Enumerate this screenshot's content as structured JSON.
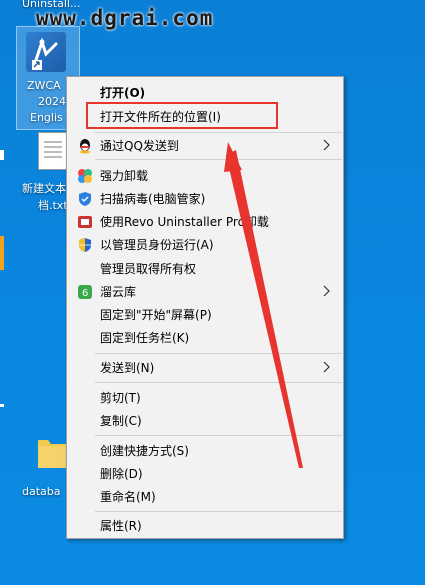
{
  "desktop": {
    "top_label": "Uninstall...",
    "watermark": "www.dgrai.com",
    "icons": [
      {
        "label_lines": [
          "ZWCA",
          "2024",
          "Englis"
        ]
      },
      {
        "label_lines": [
          "新建文本",
          "档.txt"
        ]
      },
      {
        "label_lines": [
          "databa"
        ]
      }
    ]
  },
  "context_menu": {
    "items": [
      {
        "label": "打开(O)",
        "bold": true
      },
      {
        "label": "打开文件所在的位置(I)"
      },
      {
        "label": "通过QQ发送到",
        "icon": "qq-icon",
        "submenu": true
      },
      {
        "label": "强力卸载",
        "icon": "pinwheel-icon"
      },
      {
        "label": "扫描病毒(电脑管家)",
        "icon": "shield-icon"
      },
      {
        "label": "使用Revo Uninstaller Pro卸载",
        "icon": "revo-icon"
      },
      {
        "label": "以管理员身份运行(A)",
        "icon": "uac-shield-icon"
      },
      {
        "label": "管理员取得所有权"
      },
      {
        "label": "溜云库",
        "icon": "cloud-six-icon",
        "submenu": true
      },
      {
        "label": "固定到\"开始\"屏幕(P)"
      },
      {
        "label": "固定到任务栏(K)"
      },
      {
        "label": "发送到(N)",
        "submenu": true
      },
      {
        "label": "剪切(T)"
      },
      {
        "label": "复制(C)"
      },
      {
        "label": "创建快捷方式(S)"
      },
      {
        "label": "删除(D)"
      },
      {
        "label": "重命名(M)"
      },
      {
        "label": "属性(R)"
      }
    ]
  },
  "colors": {
    "highlight": "#e8342f",
    "menu_bg": "#f2f2f2",
    "desktop": "#0b86de"
  }
}
